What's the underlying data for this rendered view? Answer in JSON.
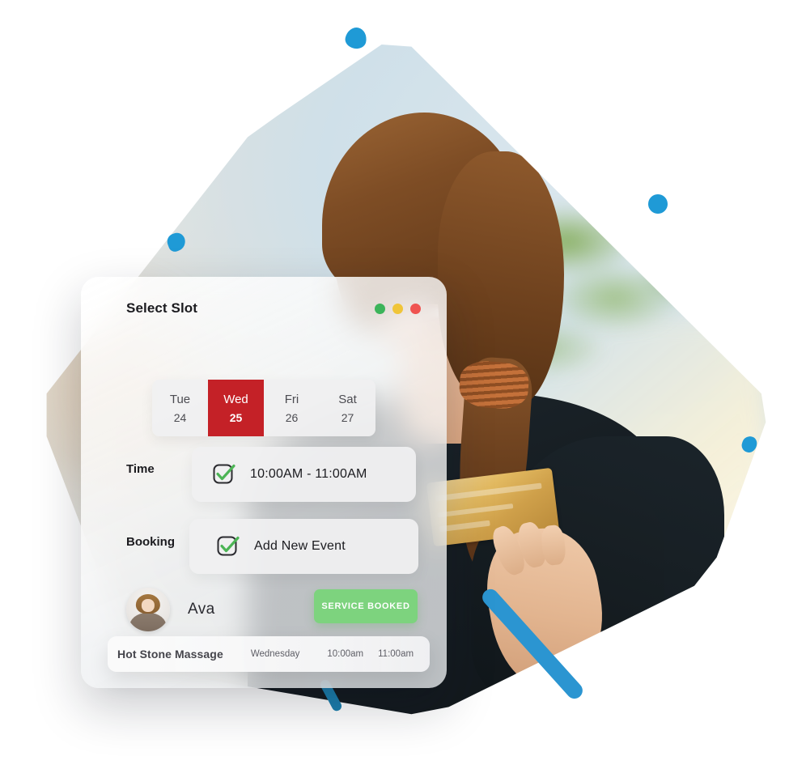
{
  "panel": {
    "title": "Select Slot",
    "window_controls": [
      {
        "name": "minimize",
        "color": "#3cb45a"
      },
      {
        "name": "maximize",
        "color": "#f0c539"
      },
      {
        "name": "close",
        "color": "#ef5350"
      }
    ],
    "days": [
      {
        "name": "Tue",
        "num": "24",
        "active": false
      },
      {
        "name": "Wed",
        "num": "25",
        "active": true
      },
      {
        "name": "Fri",
        "num": "26",
        "active": false
      },
      {
        "name": "Sat",
        "num": "27",
        "active": false
      }
    ],
    "time": {
      "label": "Time",
      "value": "10:00AM - 11:00AM",
      "checkbox_icon": "checkbox-checked-icon"
    },
    "booking": {
      "label": "Booking",
      "value": "Add New Event",
      "checkbox_icon": "checkbox-checked-icon"
    },
    "staff": {
      "avatar_icon": "avatar",
      "name": "Ava",
      "status_button": "SERVICE BOOKED"
    },
    "summary": {
      "service": "Hot Stone Massage",
      "day": "Wednesday",
      "start": "10:00am",
      "end": "11:00am"
    }
  },
  "colors": {
    "accent_red": "#c42127",
    "accent_green": "#7dd37e",
    "accent_blue": "#1f9ad6",
    "dot_green": "#3cb45a",
    "dot_yellow": "#f0c539",
    "dot_red": "#ef5350"
  },
  "decorations": [
    {
      "name": "blue-dot-top",
      "shape": "dot"
    },
    {
      "name": "blue-dot-right",
      "shape": "dot"
    },
    {
      "name": "blue-dot-left",
      "shape": "dot"
    },
    {
      "name": "blue-dot-far-right",
      "shape": "dot"
    },
    {
      "name": "blue-line-large",
      "shape": "line"
    },
    {
      "name": "blue-line-small",
      "shape": "line"
    }
  ]
}
